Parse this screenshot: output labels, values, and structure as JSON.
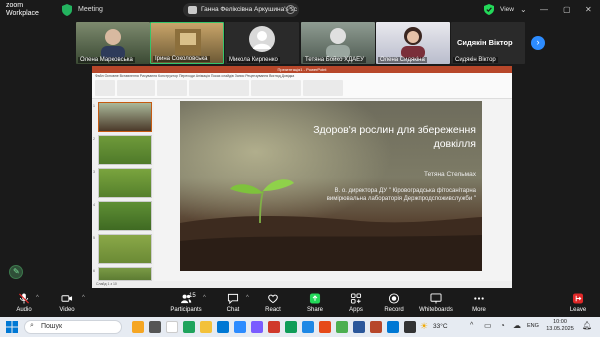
{
  "app": {
    "logo_line1": "zoom",
    "logo_line2": "Workplace",
    "meeting_label": "Meeting",
    "share_pill_text": "Ганна Феліксівна Аркушина's sc",
    "view_label": "View"
  },
  "gallery": {
    "participants": [
      {
        "name": "Олена Марковська"
      },
      {
        "name": "Ірина Соколовська"
      },
      {
        "name": "Микола Кирпенко"
      },
      {
        "name": "Тетяна Бойко ХДАЕУ"
      },
      {
        "name": "Олена Сидякіна"
      },
      {
        "name": "Сидякін Віктор",
        "display": "Сидякін Віктор"
      }
    ]
  },
  "presentation": {
    "window_title": "Презентація1 - PowerPoint",
    "ribbon_tabs": "Файл  Основне  Вставлення  Рисування  Конструктор  Переходи  Анімація  Показ слайдів  Запис  Рецензування  Вигляд  Довідка",
    "slide_title": "Здоров'я рослин для  збереження довкілля",
    "author": "Тетяна Стельмах",
    "org": "В. о. директора ДУ \" Кіровоградська фітосанітарна вимірювальна лабораторія Держпродспоживслужби \"",
    "status": "Слайд 1 з 10"
  },
  "toolbar": {
    "audio": "Audio",
    "video": "Video",
    "participants": "Participants",
    "participants_count": "15",
    "chat": "Chat",
    "react": "React",
    "share": "Share",
    "apps": "Apps",
    "record": "Record",
    "whiteboards": "Whiteboards",
    "more": "More",
    "leave": "Leave"
  },
  "taskbar": {
    "search_placeholder": "Пошук",
    "weather": "33°C",
    "lang": "ENG",
    "time": "10:00",
    "date": "13.05.2025"
  },
  "colors": {
    "zoom_blue": "#2d8cff",
    "share_green": "#23d959",
    "leave_red": "#e02828",
    "ppt_red": "#b7472a"
  }
}
